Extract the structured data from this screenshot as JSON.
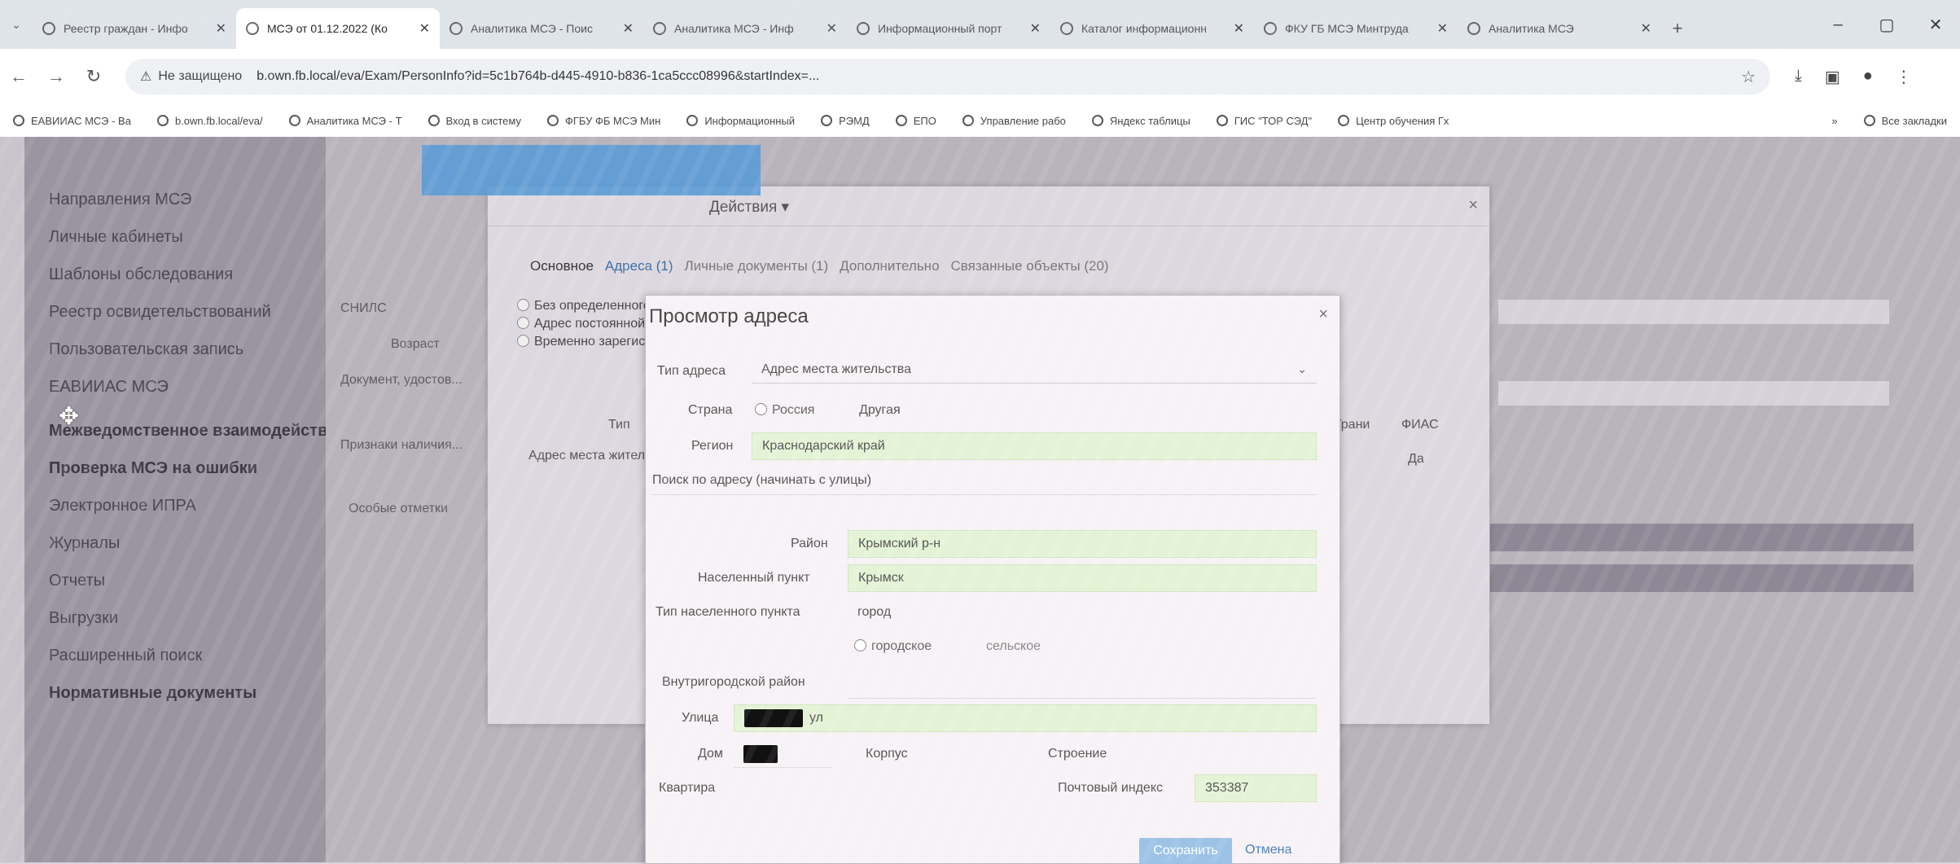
{
  "browser": {
    "tabs": [
      {
        "label": "Реестр граждан - Инфо",
        "active": false
      },
      {
        "label": "МСЭ от 01.12.2022 (Ко",
        "active": true
      },
      {
        "label": "Аналитика МСЭ - Поис",
        "active": false
      },
      {
        "label": "Аналитика МСЭ - Инф",
        "active": false
      },
      {
        "label": "Информационный порт",
        "active": false
      },
      {
        "label": "Каталог информационн",
        "active": false
      },
      {
        "label": "ФКУ ГБ МСЭ Минтруда",
        "active": false
      },
      {
        "label": "Аналитика МСЭ",
        "active": false
      }
    ],
    "address": {
      "not_secure": "Не защищено",
      "url": "b.own.fb.local/eva/Exam/PersonInfo?id=5c1b764b-d445-4910-b836-1ca5ccc08996&startIndex=..."
    },
    "bookmarks": [
      "ЕАВИИАС МСЭ - Ва",
      "b.own.fb.local/eva/",
      "Аналитика МСЭ - Т",
      "Вход в систему",
      "ФГБУ ФБ МСЭ Мин",
      "Информационный",
      "РЭМД",
      "ЕПО",
      "Управление рабо",
      "Яндекс таблицы",
      "ГИС \"ТОР СЭД\"",
      "Центр обучения Гх"
    ],
    "bookmarks_other": "Все закладки",
    "window": {
      "minimize": "–",
      "maximize": "▢",
      "close": "✕"
    }
  },
  "sidebar": {
    "items": [
      {
        "label": "Направления МСЭ",
        "bold": false
      },
      {
        "label": "Личные кабинеты",
        "bold": false
      },
      {
        "label": "Шаблоны обследования",
        "bold": false
      },
      {
        "label": "Реестр освидетельствований",
        "bold": false
      },
      {
        "label": "Пользовательская запись",
        "bold": false
      },
      {
        "label": "ЕАВИИАС МСЭ",
        "bold": false
      },
      {
        "label": "Межведомственное взаимодействие",
        "bold": true
      },
      {
        "label": "Проверка МСЭ на ошибки",
        "bold": true
      },
      {
        "label": "Электронное ИПРА",
        "bold": false
      },
      {
        "label": "Журналы",
        "bold": false
      },
      {
        "label": "Отчеты",
        "bold": false
      },
      {
        "label": "Выгрузки",
        "bold": false
      },
      {
        "label": "Расширенный поиск",
        "bold": false
      },
      {
        "label": "Нормативные документы",
        "bold": true
      }
    ]
  },
  "outer_modal": {
    "actions_label": "Действия ▾",
    "tabs": [
      "Основное",
      "Адреса (1)",
      "Личные документы (1)",
      "Дополнительно",
      "Связанные объекты (20)"
    ],
    "options": [
      "Без определенного места жительства",
      "Адрес постоянной регистрации",
      "Временно зарегистрирован"
    ],
    "col_type": "Тип",
    "addr_label": "Адрес места жительства",
    "col_fias": "ФИАС",
    "fias_value": "Да",
    "col_grani": "Грани",
    "left_labels": [
      "СНИЛС",
      "Возраст",
      "Документ, удостов...",
      "Признаки наличия...",
      "Особые отметки"
    ]
  },
  "dialog": {
    "title": "Просмотр адреса",
    "close": "×",
    "fields": {
      "address_type": {
        "label": "Тип адреса",
        "value": "Адрес места жительства"
      },
      "country": {
        "label": "Страна",
        "option1": "Россия",
        "option2": "Другая"
      },
      "region": {
        "label": "Регион",
        "value": "Краснодарский край"
      },
      "search": {
        "label": "Поиск по адресу (начинать с улицы)"
      },
      "district": {
        "label": "Район",
        "value": "Крымский р-н"
      },
      "settlement": {
        "label": "Населенный пункт",
        "value": "Крымск"
      },
      "settlement_type": {
        "label": "Тип населенного пункта",
        "value": "город",
        "option1": "городское",
        "option2": "сельское"
      },
      "intracity": {
        "label": "Внутригородской район"
      },
      "street": {
        "label": "Улица",
        "suffix": "ул"
      },
      "house": {
        "label": "Дом"
      },
      "building": {
        "label": "Корпус"
      },
      "structure": {
        "label": "Строение"
      },
      "apartment": {
        "label": "Квартира"
      },
      "postal": {
        "label": "Почтовый индекс",
        "value": "353387"
      }
    },
    "buttons": {
      "save": "Сохранить",
      "cancel": "Отмена"
    }
  }
}
